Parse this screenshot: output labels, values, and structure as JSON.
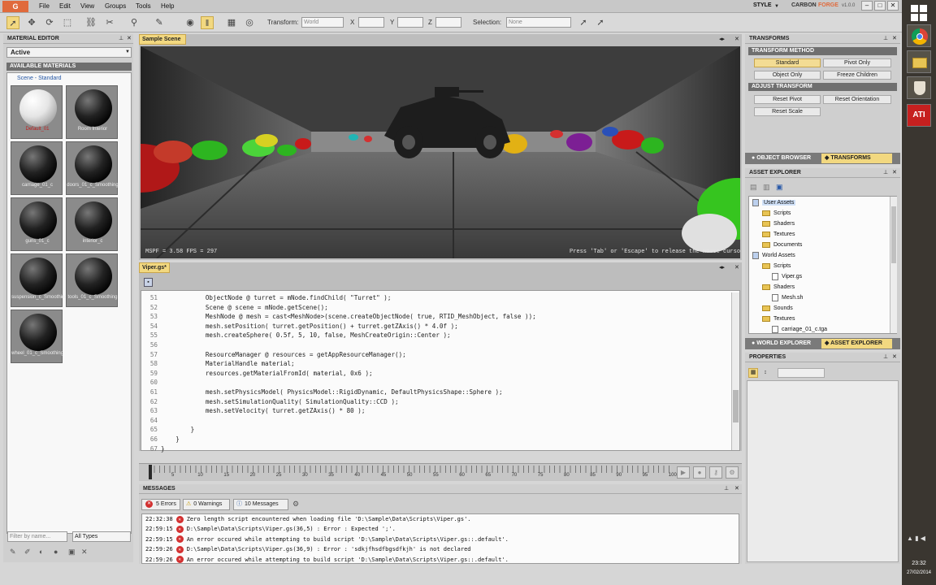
{
  "app": {
    "logo": "G"
  },
  "menu": [
    "File",
    "Edit",
    "View",
    "Groups",
    "Tools",
    "Help"
  ],
  "topright": {
    "style_label": "STYLE",
    "app_name": "CARBON",
    "app_sub": "FORGE",
    "version": "v1.0.0"
  },
  "toolbar": {
    "transform_label": "Transform:",
    "transform_value": "World",
    "x_label": "X",
    "y_label": "Y",
    "z_label": "Z",
    "selection_label": "Selection:",
    "selection_value": "None"
  },
  "material_editor": {
    "title": "MATERIAL EDITOR",
    "dropdown": "Active",
    "section": "AVAILABLE MATERIALS",
    "scene_label": "Scene - Standard",
    "items": [
      "Default_01",
      "Room Interior",
      "carriage_01_c",
      "doors_01_c_Smoothing",
      "guns_01_c",
      "interior_c",
      "suspension_c_Smoothing",
      "tools_01_c_Smoothing",
      "wheel_01_c_Smoothing"
    ],
    "filter_placeholder": "Filter by name...",
    "filter_type": "All Types"
  },
  "viewport": {
    "tab": "Sample Scene",
    "stats": "MSPF = 3.58   FPS = 297",
    "hint": "Press 'Tab' or 'Escape' to release the mouse cursor"
  },
  "code_editor": {
    "tab": "Viper.gs*",
    "lines": [
      {
        "n": "51",
        "t": "            ObjectNode @ turret = mNode.findChild( \"Turret\" );"
      },
      {
        "n": "52",
        "t": "            Scene @ scene = mNode.getScene();"
      },
      {
        "n": "53",
        "t": "            MeshNode @ mesh = cast<MeshNode>(scene.createObjectNode( true, RTID_MeshObject, false ));"
      },
      {
        "n": "54",
        "t": "            mesh.setPosition( turret.getPosition() + turret.getZAxis() * 4.0f );"
      },
      {
        "n": "55",
        "t": "            mesh.createSphere( 0.5f, 5, 10, false, MeshCreateOrigin::Center );"
      },
      {
        "n": "56",
        "t": ""
      },
      {
        "n": "57",
        "t": "            ResourceManager @ resources = getAppResourceManager();"
      },
      {
        "n": "58",
        "t": "            MaterialHandle material;"
      },
      {
        "n": "59",
        "t": "            resources.getMaterialFromId( material, 0x6 );"
      },
      {
        "n": "60",
        "t": ""
      },
      {
        "n": "61",
        "t": "            mesh.setPhysicsModel( PhysicsModel::RigidDynamic, DefaultPhysicsShape::Sphere );"
      },
      {
        "n": "62",
        "t": "            mesh.setSimulationQuality( SimulationQuality::CCD );"
      },
      {
        "n": "63",
        "t": "            mesh.setVelocity( turret.getZAxis() * 80 );"
      },
      {
        "n": "64",
        "t": ""
      },
      {
        "n": "65",
        "t": "        }"
      },
      {
        "n": "66",
        "t": "    }"
      },
      {
        "n": "67",
        "t": "}"
      }
    ]
  },
  "timeline": {
    "ticks": [
      "5",
      "10",
      "15",
      "20",
      "25",
      "30",
      "35",
      "40",
      "45",
      "50",
      "55",
      "60",
      "65",
      "70",
      "75",
      "80",
      "85",
      "90",
      "95",
      "100"
    ]
  },
  "messages": {
    "title": "MESSAGES",
    "errors": "5 Errors",
    "warnings": "0 Warnings",
    "infos": "10 Messages",
    "rows": [
      {
        "time": "22:32:38",
        "text": "Zero length script encountered when loading file 'D:\\Sample\\Data\\Scripts\\Viper.gs'."
      },
      {
        "time": "22:59:15",
        "text": "D:\\Sample\\Data\\Scripts\\Viper.gs(36,5) : Error : Expected ';'."
      },
      {
        "time": "22:59:15",
        "text": "An error occured while attempting to build script 'D:\\Sample\\Data\\Scripts\\Viper.gs::.default'."
      },
      {
        "time": "22:59:26",
        "text": "D:\\Sample\\Data\\Scripts\\Viper.gs(36,9) : Error : 'sdkjfhsdfbgsdfkjh' is not declared"
      },
      {
        "time": "22:59:26",
        "text": "An error occured while attempting to build script 'D:\\Sample\\Data\\Scripts\\Viper.gs::.default'."
      }
    ]
  },
  "transforms": {
    "title": "TRANSFORMS",
    "method_header": "TRANSFORM METHOD",
    "method_buttons": [
      "Standard",
      "Pivot Only",
      "Object Only",
      "Freeze Children"
    ],
    "adjust_header": "ADJUST TRANSFORM",
    "adjust_buttons": [
      "Reset Pivot",
      "Reset Orientation",
      "Reset Scale"
    ],
    "tab_object_browser": "OBJECT BROWSER",
    "tab_transforms": "TRANSFORMS"
  },
  "asset_explorer": {
    "title": "ASSET EXPLORER",
    "tree": [
      {
        "label": "User Assets",
        "depth": 0,
        "kind": "root"
      },
      {
        "label": "Scripts",
        "depth": 1,
        "kind": "folder"
      },
      {
        "label": "Shaders",
        "depth": 1,
        "kind": "folder"
      },
      {
        "label": "Textures",
        "depth": 1,
        "kind": "folder"
      },
      {
        "label": "Documents",
        "depth": 1,
        "kind": "folder"
      },
      {
        "label": "World Assets",
        "depth": 0,
        "kind": "root"
      },
      {
        "label": "Scripts",
        "depth": 1,
        "kind": "folder"
      },
      {
        "label": "Viper.gs",
        "depth": 2,
        "kind": "file"
      },
      {
        "label": "Shaders",
        "depth": 1,
        "kind": "folder"
      },
      {
        "label": "Mesh.sh",
        "depth": 2,
        "kind": "file"
      },
      {
        "label": "Sounds",
        "depth": 1,
        "kind": "folder"
      },
      {
        "label": "Textures",
        "depth": 1,
        "kind": "folder"
      },
      {
        "label": "carriage_01_c.tga",
        "depth": 2,
        "kind": "file"
      }
    ],
    "tab_world_explorer": "WORLD EXPLORER",
    "tab_asset_explorer": "ASSET EXPLORER"
  },
  "properties": {
    "title": "PROPERTIES"
  },
  "taskbar": {
    "time": "23:32",
    "date": "27/02/2014",
    "ati": "ATI"
  }
}
